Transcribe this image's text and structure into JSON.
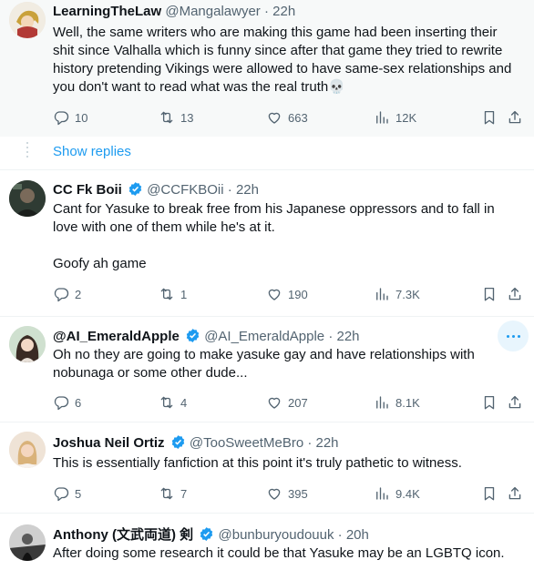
{
  "tweets": [
    {
      "name": "LearningTheLaw",
      "handle": "@Mangalawyer",
      "time": "22h",
      "verified": false,
      "text": "Well, the same writers who are making this game had been inserting their shit since Valhalla which is funny since after that game they tried to rewrite history pretending Vikings were allowed to have same-sex relationships and you don't want to read what was the real truth💀",
      "replies": "10",
      "reposts": "13",
      "likes": "663",
      "views": "12K"
    },
    {
      "name": "CC Fk Boii",
      "handle": "@CCFKBOii",
      "time": "22h",
      "verified": true,
      "text_line1": "Cant for Yasuke to break free from his Japanese oppressors and to fall in love with one of them while he's at it.",
      "text_line2": "Goofy ah game",
      "replies": "2",
      "reposts": "1",
      "likes": "190",
      "views": "7.3K"
    },
    {
      "name": "@AI_EmeraldApple",
      "handle": "@AI_EmeraldApple",
      "time": "22h",
      "verified": true,
      "text": "Oh no they are going to make yasuke gay and have relationships with nobunaga or some other dude...",
      "replies": "6",
      "reposts": "4",
      "likes": "207",
      "views": "8.1K"
    },
    {
      "name": "Joshua Neil Ortiz",
      "handle": "@TooSweetMeBro",
      "time": "22h",
      "verified": true,
      "text": "This is essentially fanfiction at this point it's truly pathetic to witness.",
      "replies": "5",
      "reposts": "7",
      "likes": "395",
      "views": "9.4K"
    },
    {
      "name": "Anthony (文武両道) 剣",
      "handle": "@bunburyoudouuk",
      "time": "20h",
      "verified": true,
      "text": "After doing some research it could be that Yasuke may be an LGBTQ icon."
    }
  ],
  "show_replies": "Show replies",
  "separator": "·",
  "colors": {
    "accent": "#1d9bf0",
    "muted": "#536471",
    "text": "#0f1419",
    "highlight_bg": "#f7f9f9"
  },
  "icons": [
    "reply-icon",
    "repost-icon",
    "like-icon",
    "views-icon",
    "bookmark-icon",
    "share-icon",
    "verified-badge-icon",
    "more-icon"
  ]
}
